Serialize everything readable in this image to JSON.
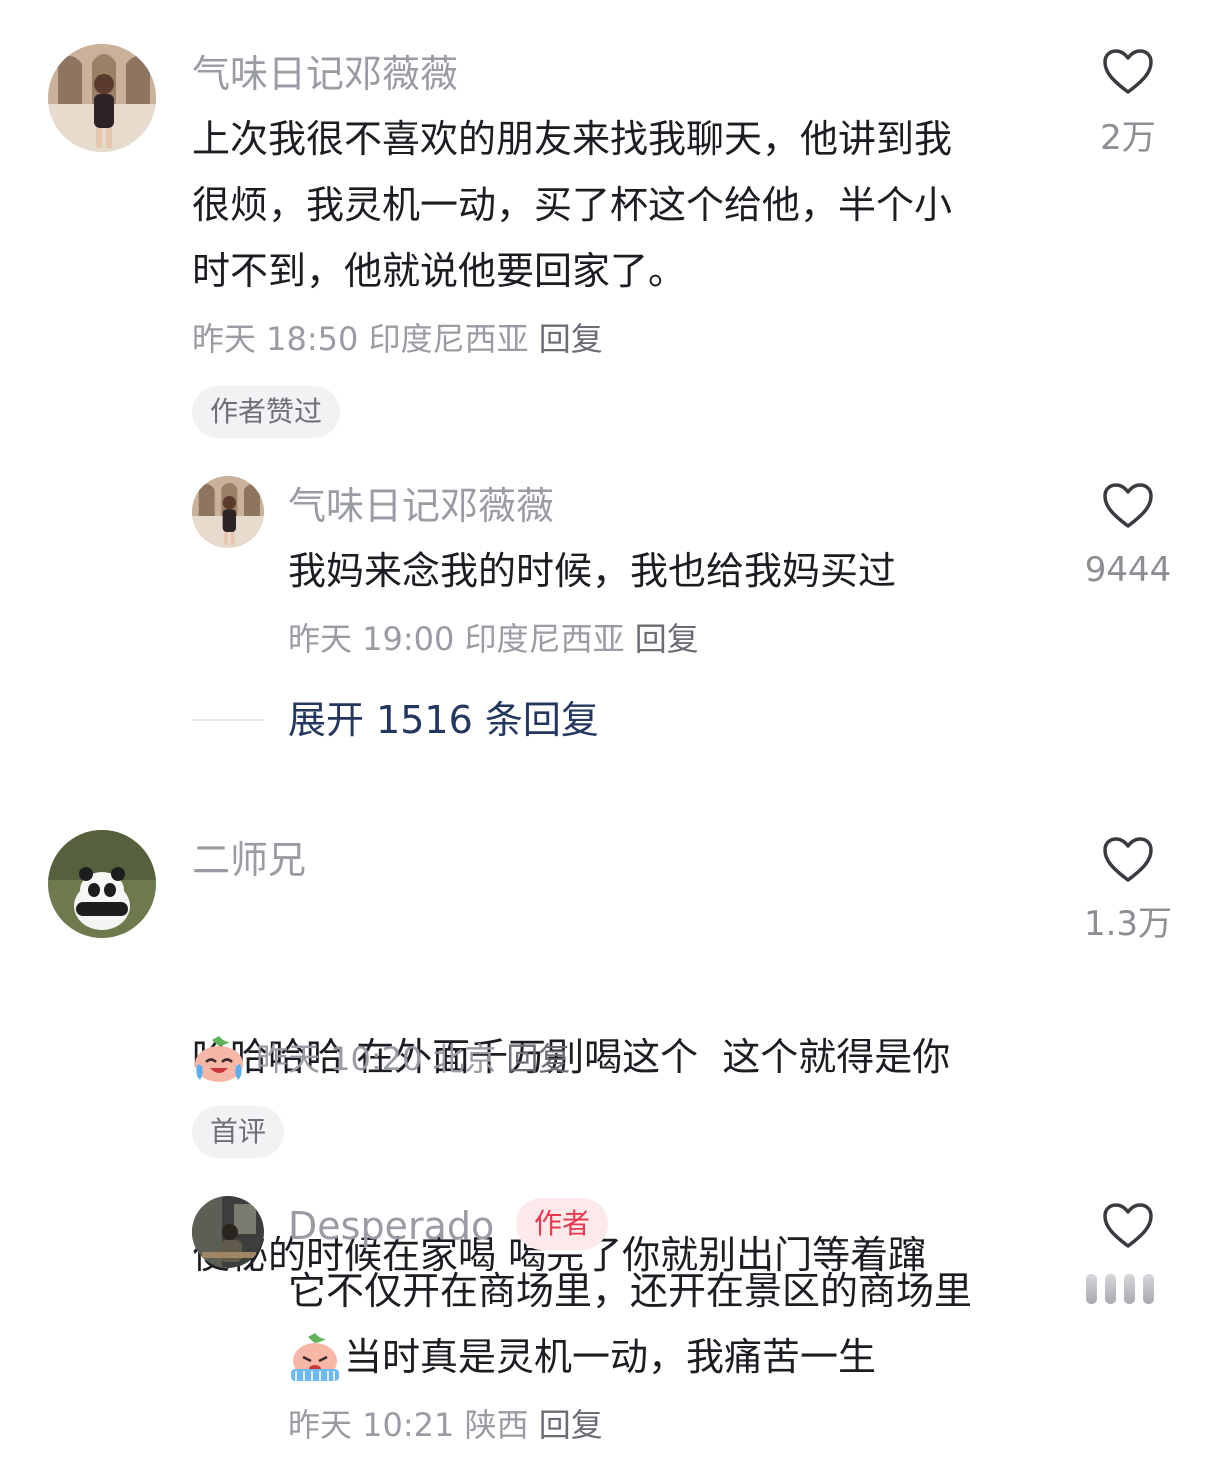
{
  "comments": [
    {
      "user": "气味日记邓薇薇",
      "text_lines": [
        "上次我很不喜欢的朋友来找我聊天，他讲到我",
        "很烦，我灵机一动，买了杯这个给他，半个小",
        "时不到，他就说他要回家了。"
      ],
      "time": "昨天 18:50",
      "location": "印度尼西亚",
      "reply_label": "回复",
      "likes": "2万",
      "tag": "作者赞过"
    },
    {
      "user": "气味日记邓薇薇",
      "text_lines": [
        "我妈来念我的时候，我也给我妈买过"
      ],
      "time": "昨天 19:00",
      "location": "印度尼西亚",
      "reply_label": "回复",
      "likes": "9444"
    },
    {
      "expand_label": "展开 1516 条回复"
    },
    {
      "user": "二师兄",
      "text_lines": [
        "哈哈哈哈 在外面千万别喝这个  这个就得是你",
        "便秘的时候在家喝 喝完了你就别出门等着蹿"
      ],
      "time": "昨天 10:20",
      "location": "北京",
      "reply_label": "回复",
      "likes": "1.3万",
      "tag": "首评",
      "reaction_icon": "laughing-crying-face-icon"
    },
    {
      "user": "Desperado",
      "badge": "作者",
      "text_lines": [
        "它不仅开在商场里，还开在景区的商场里",
        "当时真是灵机一动，我痛苦一生"
      ],
      "time": "昨天 10:21",
      "location": "陕西",
      "reply_label": "回复",
      "inline_icon": "sweating-crying-face-icon"
    }
  ],
  "colors": {
    "name": "#9a9ca3",
    "text": "#1c1d22",
    "expand": "#24375e",
    "author_badge_bg": "#fde8ea",
    "author_badge_text": "#e8364f"
  }
}
